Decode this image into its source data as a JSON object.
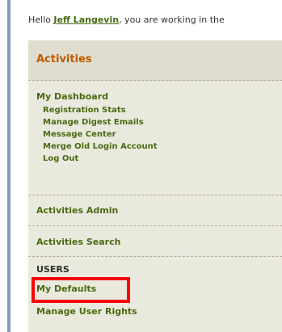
{
  "greeting": {
    "prefix": "Hello ",
    "user_name": "Jeff Langevin",
    "suffix": ", you are working in the"
  },
  "menu": {
    "header": "Activities",
    "dashboard": {
      "label": "My Dashboard",
      "items": [
        "Registration Stats",
        "Manage Digest Emails",
        "Message Center",
        "Merge Old Login Account",
        "Log Out"
      ]
    },
    "activities_admin": "Activities Admin",
    "activities_search": "Activities Search",
    "users_section": "USERS",
    "my_defaults": "My Defaults",
    "manage_user_rights": "Manage User Rights"
  },
  "colors": {
    "link_green": "#4a6a12",
    "header_orange": "#c05a00",
    "highlight_red": "#ff0000"
  }
}
